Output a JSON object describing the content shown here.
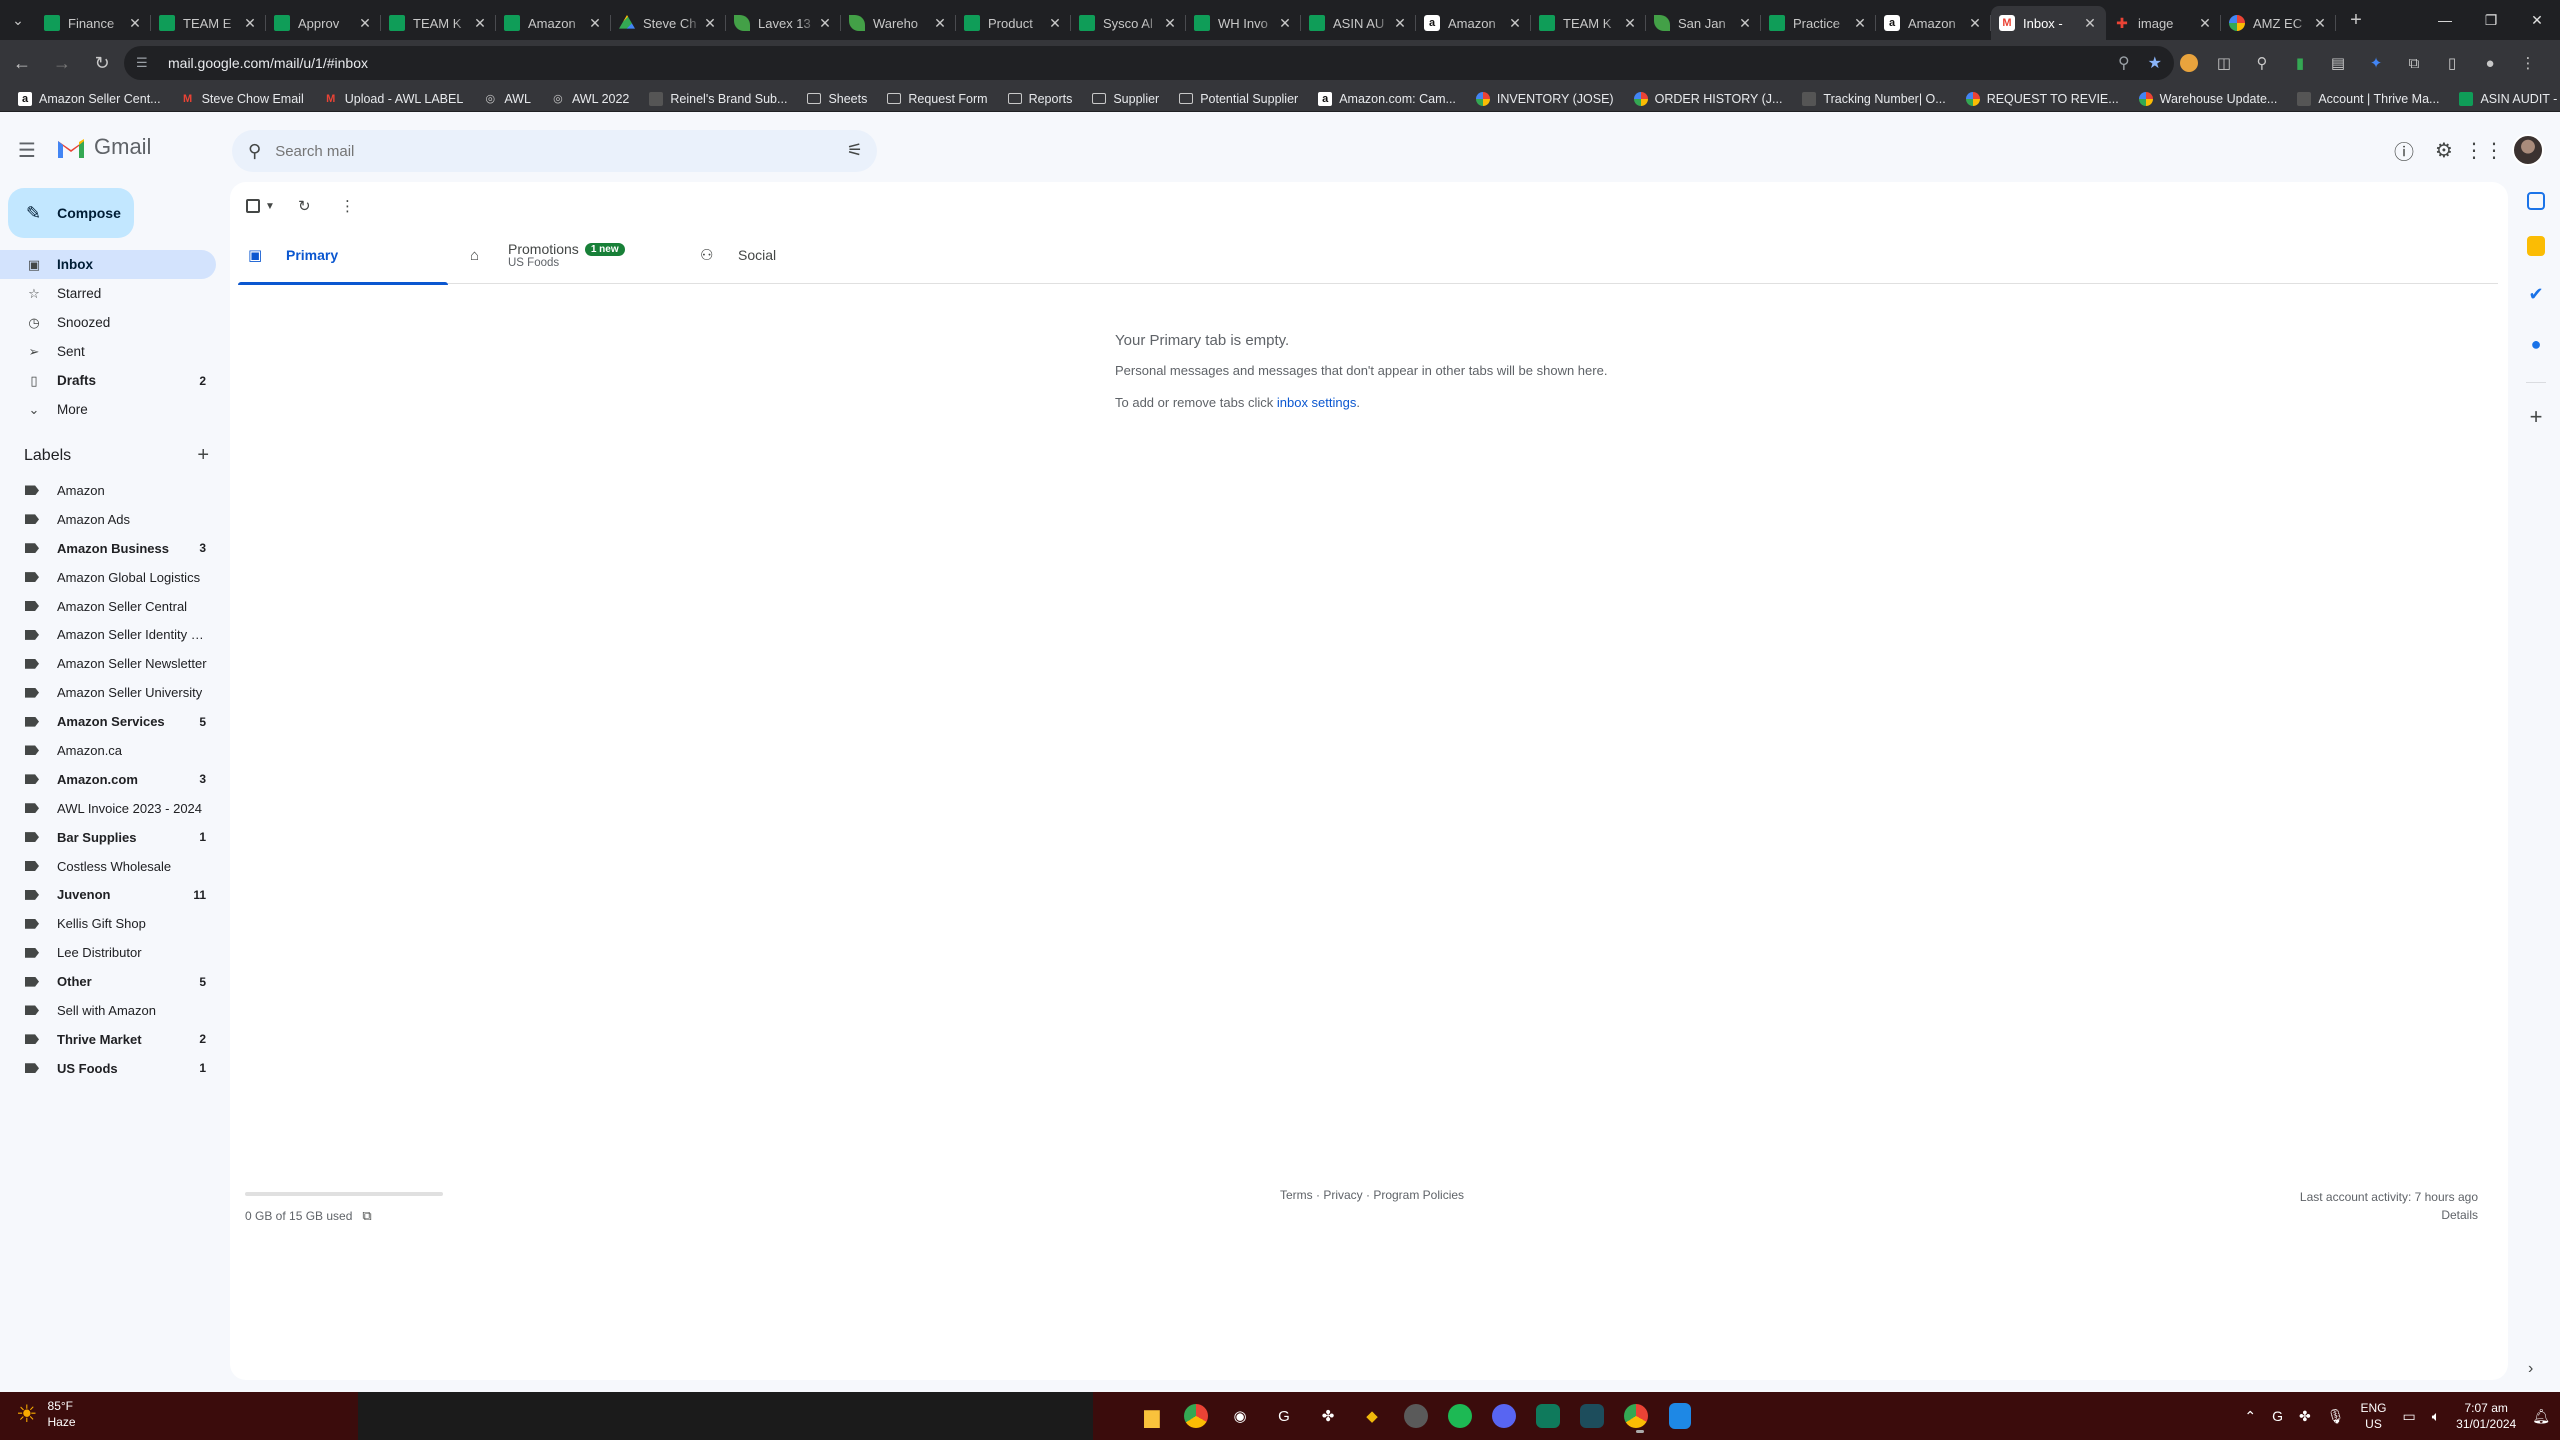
{
  "browser": {
    "tabs": [
      {
        "title": "Finance",
        "favicon": "sheets-icon"
      },
      {
        "title": "TEAM E",
        "favicon": "sheets-icon"
      },
      {
        "title": "Approv",
        "favicon": "sheets-icon"
      },
      {
        "title": "TEAM K",
        "favicon": "sheets-icon"
      },
      {
        "title": "Amazon",
        "favicon": "sheets-icon"
      },
      {
        "title": "Steve Ch",
        "favicon": "drive-icon"
      },
      {
        "title": "Lavex 13",
        "favicon": "leaf-icon"
      },
      {
        "title": "Wareho",
        "favicon": "leaf-icon"
      },
      {
        "title": "Product",
        "favicon": "sheets-icon"
      },
      {
        "title": "Sysco Al",
        "favicon": "sheets-icon"
      },
      {
        "title": "WH Invo",
        "favicon": "sheets-icon"
      },
      {
        "title": "ASIN AU",
        "favicon": "sheets-icon"
      },
      {
        "title": "Amazon",
        "favicon": "amazon-icon"
      },
      {
        "title": "TEAM K",
        "favicon": "sheets-icon"
      },
      {
        "title": "San Jan",
        "favicon": "leaf-icon"
      },
      {
        "title": "Practice",
        "favicon": "sheets-icon"
      },
      {
        "title": "Amazon",
        "favicon": "amazon-icon"
      },
      {
        "title": "Inbox - ",
        "favicon": "gmail-icon",
        "active": true
      },
      {
        "title": "image",
        "favicon": "image-icon"
      },
      {
        "title": "AMZ EC",
        "favicon": "multi-icon"
      }
    ],
    "url": "mail.google.com/mail/u/1/#inbox",
    "bookmarks": [
      {
        "label": "Amazon Seller Cent...",
        "icon": "amazon-icon"
      },
      {
        "label": "Steve Chow Email",
        "icon": "gmail-icon"
      },
      {
        "label": "Upload - AWL LABEL",
        "icon": "gmail-icon"
      },
      {
        "label": "AWL",
        "icon": "globe-icon"
      },
      {
        "label": "AWL 2022",
        "icon": "globe-icon"
      },
      {
        "label": "Reinel's Brand Sub...",
        "icon": "page-icon"
      },
      {
        "label": "Sheets",
        "icon": "folder-icon"
      },
      {
        "label": "Request Form",
        "icon": "folder-icon"
      },
      {
        "label": "Reports",
        "icon": "folder-icon"
      },
      {
        "label": "Supplier",
        "icon": "folder-icon"
      },
      {
        "label": "Potential Supplier",
        "icon": "folder-icon"
      },
      {
        "label": "Amazon.com: Cam...",
        "icon": "amazon-icon"
      },
      {
        "label": "INVENTORY (JOSE)",
        "icon": "multi-icon"
      },
      {
        "label": "ORDER HISTORY (J...",
        "icon": "multi-icon"
      },
      {
        "label": "Tracking Number| O...",
        "icon": "page-icon"
      },
      {
        "label": "REQUEST TO REVIE...",
        "icon": "multi-icon"
      },
      {
        "label": "Warehouse Update...",
        "icon": "multi-icon"
      },
      {
        "label": "Account | Thrive Ma...",
        "icon": "page-icon"
      },
      {
        "label": "ASIN AUDIT - Googl...",
        "icon": "sheets-icon"
      }
    ]
  },
  "gmail": {
    "brand": "Gmail",
    "search_placeholder": "Search mail",
    "compose_label": "Compose",
    "nav": [
      {
        "label": "Inbox",
        "icon": "inbox-icon",
        "count": "",
        "active": true
      },
      {
        "label": "Starred",
        "icon": "star-icon",
        "count": ""
      },
      {
        "label": "Snoozed",
        "icon": "clock-icon",
        "count": ""
      },
      {
        "label": "Sent",
        "icon": "send-icon",
        "count": ""
      },
      {
        "label": "Drafts",
        "icon": "draft-icon",
        "count": "2",
        "bold": true
      },
      {
        "label": "More",
        "icon": "chevron-down-icon",
        "count": ""
      }
    ],
    "labels_title": "Labels",
    "labels": [
      {
        "name": "Amazon",
        "count": "",
        "bold": false
      },
      {
        "name": "Amazon Ads",
        "count": "",
        "bold": false
      },
      {
        "name": "Amazon Business",
        "count": "3",
        "bold": true
      },
      {
        "name": "Amazon Global Logistics",
        "count": "",
        "bold": false
      },
      {
        "name": "Amazon Seller Central",
        "count": "",
        "bold": false
      },
      {
        "name": "Amazon Seller Identity V...",
        "count": "",
        "bold": false
      },
      {
        "name": "Amazon Seller Newsletter",
        "count": "",
        "bold": false
      },
      {
        "name": "Amazon Seller University",
        "count": "",
        "bold": false
      },
      {
        "name": "Amazon Services",
        "count": "5",
        "bold": true
      },
      {
        "name": "Amazon.ca",
        "count": "",
        "bold": false
      },
      {
        "name": "Amazon.com",
        "count": "3",
        "bold": true
      },
      {
        "name": "AWL Invoice 2023 - 2024",
        "count": "",
        "bold": false
      },
      {
        "name": "Bar Supplies",
        "count": "1",
        "bold": true
      },
      {
        "name": "Costless Wholesale",
        "count": "",
        "bold": false
      },
      {
        "name": "Juvenon",
        "count": "11",
        "bold": true
      },
      {
        "name": "Kellis Gift Shop",
        "count": "",
        "bold": false
      },
      {
        "name": "Lee Distributor",
        "count": "",
        "bold": false
      },
      {
        "name": "Other",
        "count": "5",
        "bold": true
      },
      {
        "name": "Sell with Amazon",
        "count": "",
        "bold": false
      },
      {
        "name": "Thrive Market",
        "count": "2",
        "bold": true
      },
      {
        "name": "US Foods",
        "count": "1",
        "bold": true
      }
    ],
    "tabs": {
      "primary": "Primary",
      "promotions": "Promotions",
      "promotions_badge": "1 new",
      "promotions_sub": "US Foods",
      "social": "Social"
    },
    "empty": {
      "title": "Your Primary tab is empty.",
      "line1": "Personal messages and messages that don't appear in other tabs will be shown here.",
      "line2_prefix": "To add or remove tabs click ",
      "line2_link": "inbox settings",
      "line2_suffix": "."
    },
    "storage_text": "0 GB of 15 GB used",
    "storage_used_fraction": 0,
    "footer_links": "Terms · Privacy · Program Policies",
    "last_activity": "Last account activity: 7 hours ago",
    "details_link": "Details"
  },
  "taskbar": {
    "temperature": "85°F",
    "condition": "Haze",
    "lang": "ENG",
    "region": "US",
    "time": "7:07 am",
    "date": "31/01/2024"
  },
  "colors": {
    "accent": "#0b57d0",
    "compose_bg": "#c2e7ff",
    "active_nav": "#d3e3fd",
    "badge_green": "#188038",
    "taskbar": "#3b0c0c"
  }
}
